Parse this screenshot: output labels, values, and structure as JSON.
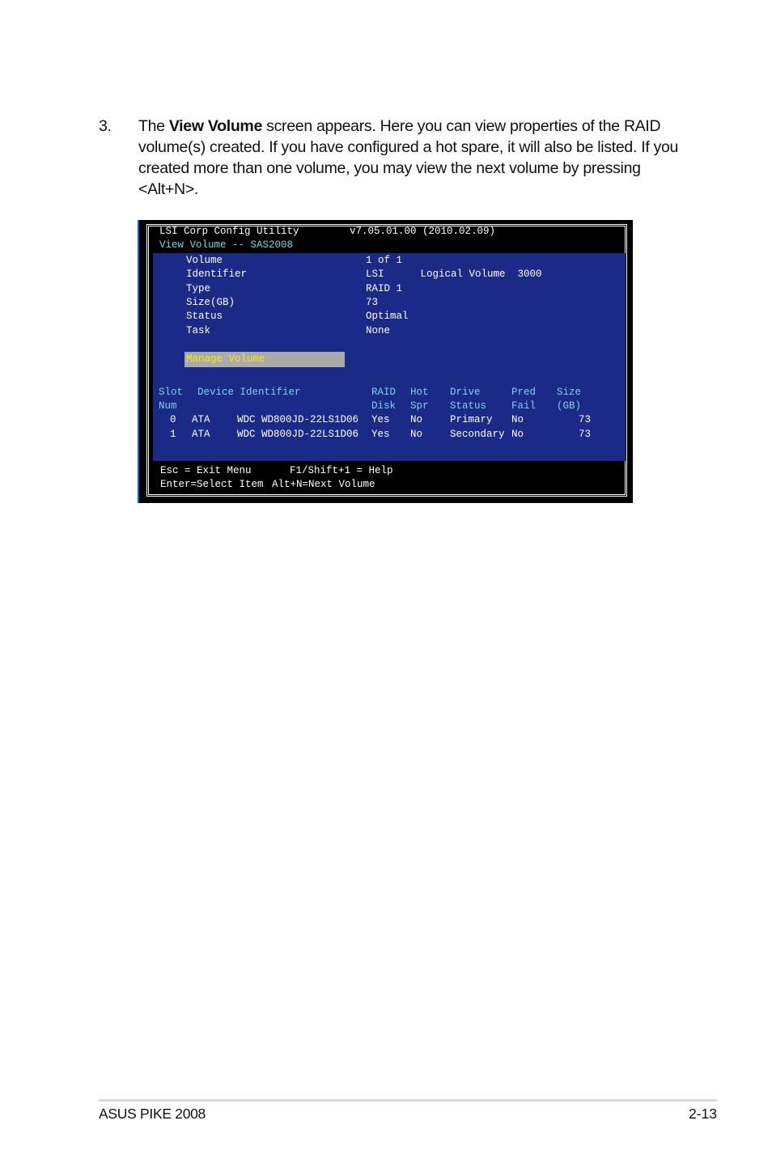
{
  "intro": {
    "step_number": "3.",
    "text_before": "The ",
    "bold": "View Volume",
    "text_after": " screen appears. Here you can view properties of the RAID volume(s) created. If you have configured a hot spare, it will also be listed. If you created more than one volume, you may view the next volume by pressing <Alt+N>."
  },
  "screen": {
    "title": "LSI Corp Config Utility",
    "version": "v7.05.01.00 (2010.02.09)",
    "subtitle": "View Volume -- SAS2008",
    "properties": [
      {
        "label": "Volume",
        "value": "1 of 1"
      },
      {
        "label": "Identifier",
        "value": "LSI      Logical Volume  3000"
      },
      {
        "label": "Type",
        "value": "RAID 1"
      },
      {
        "label": "Size(GB)",
        "value": "73"
      },
      {
        "label": "Status",
        "value": "Optimal"
      },
      {
        "label": "Task",
        "value": "None"
      }
    ],
    "manage_volume": "Manage Volume",
    "table": {
      "headers": [
        {
          "line1": "Slot",
          "line2": "Num"
        },
        {
          "line1": "Device Identifier",
          "line2": ""
        },
        {
          "line1": "RAID",
          "line2": "Disk"
        },
        {
          "line1": "Hot",
          "line2": "Spr"
        },
        {
          "line1": "Drive",
          "line2": "Status"
        },
        {
          "line1": "Pred",
          "line2": "Fail"
        },
        {
          "line1": "Size",
          "line2": "(GB)"
        }
      ],
      "rows": [
        {
          "slot": "0",
          "vendor": "ATA",
          "device": "WDC WD800JD-22LS1D06",
          "raid_disk": "Yes",
          "hot_spare": "No",
          "drive_status": "Primary",
          "pred_fail": "No",
          "size": "73"
        },
        {
          "slot": "1",
          "vendor": "ATA",
          "device": "WDC WD800JD-22LS1D06",
          "raid_disk": "Yes",
          "hot_spare": "No",
          "drive_status": "Secondary",
          "pred_fail": "No",
          "size": "73"
        }
      ]
    },
    "footer": {
      "esc": "Esc = Exit Menu",
      "help": "F1/Shift+1 = Help",
      "enter": "Enter=Select Item",
      "altn": "Alt+N=Next Volume"
    }
  },
  "page_footer": {
    "left": "ASUS PIKE 2008",
    "right": "2-13"
  }
}
